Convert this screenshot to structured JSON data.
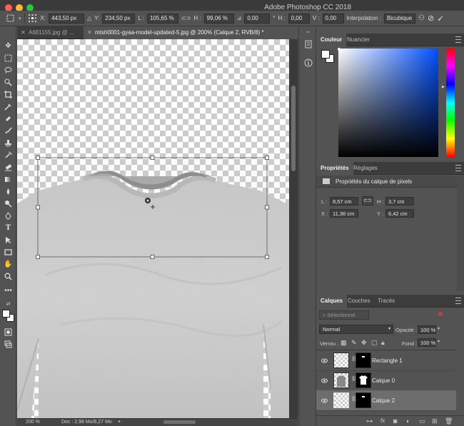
{
  "app": {
    "title": "Adobe Photoshop CC 2018"
  },
  "options_bar": {
    "x_label": "X:",
    "x_value": "443,50 px",
    "y_label": "Y:",
    "y_value": "234,50 px",
    "l_label": "L :",
    "l_value": "105,65 %",
    "h_label": "H :",
    "h_value": "99,06 %",
    "angle_value": "0,00",
    "angle_unit": "°",
    "hskew_label": "H :",
    "hskew_value": "0,00",
    "vskew_label": "V :",
    "vskew_value": "0,00",
    "interp_label": "Interpolation :",
    "interp_value": "Bicubique"
  },
  "doc_tabs": [
    {
      "label": "A681155.jpg @ ..."
    },
    {
      "label": "mtsh0001-gyaa-model-updated-5.jpg @ 200% (Calque 2, RVB/8) *"
    }
  ],
  "status": {
    "zoom": "200 %",
    "doc": "Doc : 2,98 Mo/6,27 Mo"
  },
  "color_panel": {
    "tabs": [
      "Couleur",
      "Nuancier"
    ]
  },
  "properties_panel": {
    "tabs": [
      "Propriétés",
      "Réglages"
    ],
    "heading": "Propriétés du calque de pixels",
    "l_label": "L :",
    "l_value": "8,57 cm",
    "h_label": "H :",
    "h_value": "3,7 cm",
    "x_label": "X :",
    "x_value": "11,36 cm",
    "y_label": "Y :",
    "y_value": "6,42 cm"
  },
  "layers_panel": {
    "tabs": [
      "Calques",
      "Couches",
      "Tracés"
    ],
    "filter_placeholder": "Sélectionné",
    "blend_mode": "Normal",
    "opacity_label": "Opacité :",
    "opacity_value": "100 %",
    "lock_label": "Verrou :",
    "fill_label": "Fond :",
    "fill_value": "100 %",
    "layers": [
      {
        "name": "Rectangle 1",
        "selected": false
      },
      {
        "name": "Calque 0",
        "selected": false
      },
      {
        "name": "Calque 2",
        "selected": true
      }
    ]
  },
  "colors": {
    "accent": "#0050ff",
    "panel_bg": "#535353",
    "dark_bg": "#3c3c3c"
  }
}
